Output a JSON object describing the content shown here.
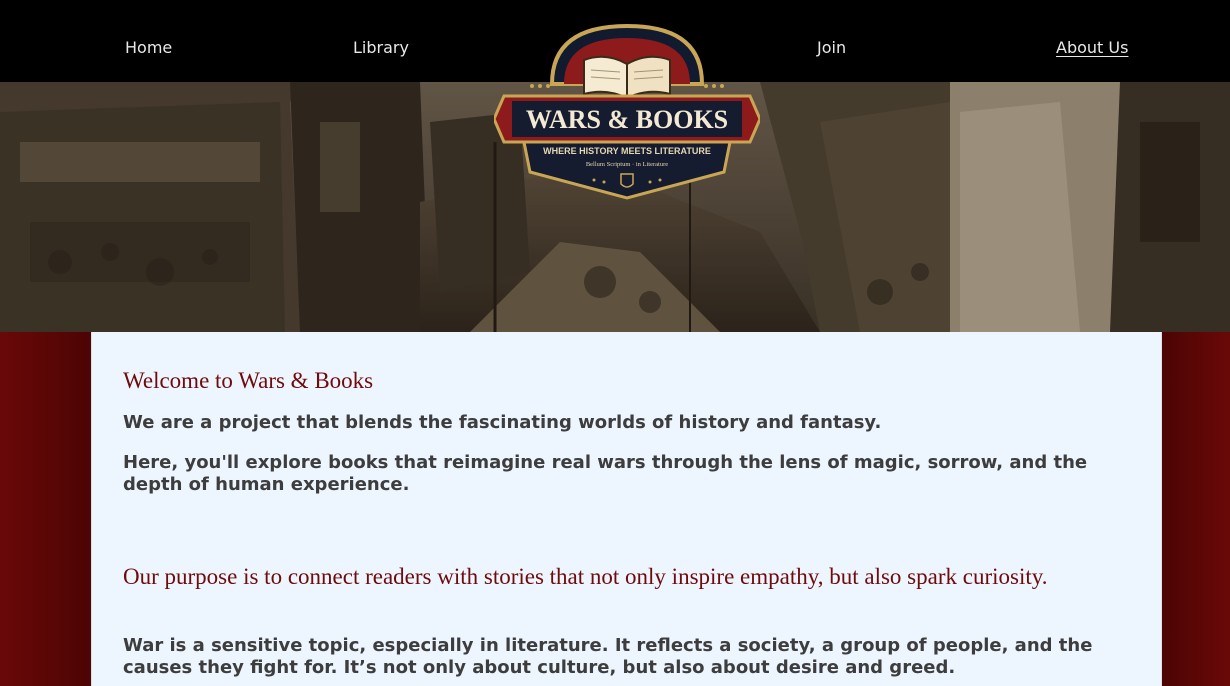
{
  "nav": {
    "home": "Home",
    "library": "Library",
    "join": "Join",
    "about": "About Us"
  },
  "logo": {
    "title": "WARS & BOOKS",
    "tagline": "WHERE HISTORY MEETS LITERATURE",
    "motto": "Bellum Scriptum · in Literature"
  },
  "content": {
    "welcome_heading": "Welcome to Wars & Books",
    "intro_1": "We are a project that blends the fascinating worlds of history and fantasy.",
    "intro_2": "Here, you'll explore books that reimagine real wars through the lens of magic, sorrow, and the depth of human experience.",
    "purpose_heading": "Our purpose is to connect readers with stories that not only inspire empathy, but also spark curiosity.",
    "purpose_text": "War is a sensitive topic, especially in literature. It reflects a society, a group of people, and the causes they fight for. It’s not only about culture, but also about desire and greed."
  },
  "colors": {
    "nav_bg": "#000000",
    "crimson": "#6e0b0b",
    "panel": "#edf5fe",
    "text": "#3d3d3d",
    "gold": "#c9a653"
  },
  "icons": [
    "open-book-icon",
    "star-icon",
    "shield-icon"
  ]
}
